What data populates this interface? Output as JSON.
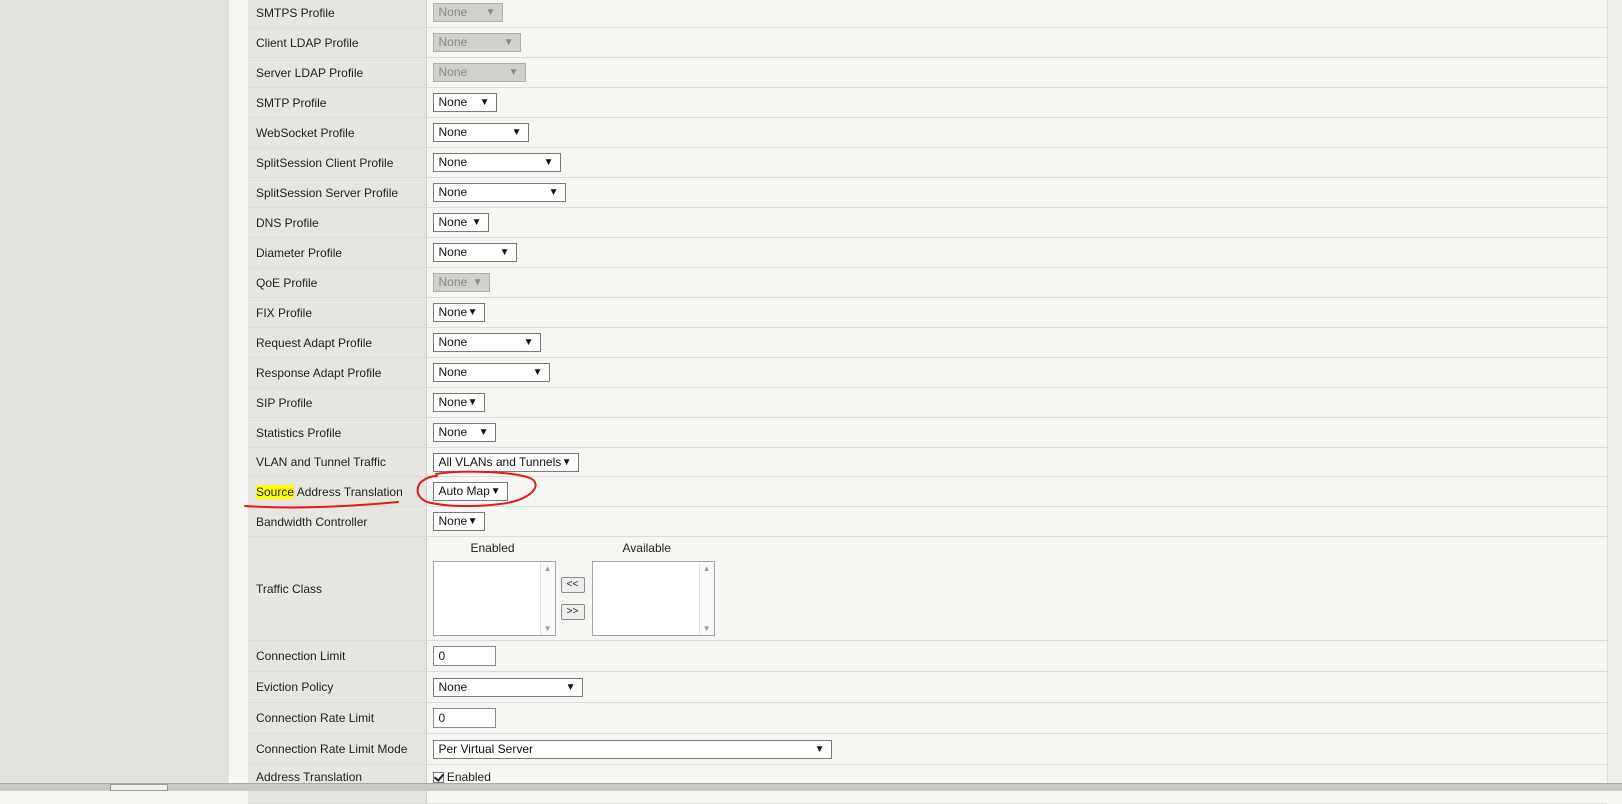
{
  "rows": [
    {
      "label": "SMTPS Profile",
      "value": "None",
      "disabled": true,
      "w": 70
    },
    {
      "label": "Client LDAP Profile",
      "value": "None",
      "disabled": true,
      "w": 88
    },
    {
      "label": "Server LDAP Profile",
      "value": "None",
      "disabled": true,
      "w": 93
    },
    {
      "label": "SMTP Profile",
      "value": "None",
      "disabled": false,
      "w": 64
    },
    {
      "label": "WebSocket Profile",
      "value": "None",
      "disabled": false,
      "w": 96
    },
    {
      "label": "SplitSession Client Profile",
      "value": "None",
      "disabled": false,
      "w": 128
    },
    {
      "label": "SplitSession Server Profile",
      "value": "None",
      "disabled": false,
      "w": 133
    },
    {
      "label": "DNS Profile",
      "value": "None",
      "disabled": false,
      "w": 56
    },
    {
      "label": "Diameter Profile",
      "value": "None",
      "disabled": false,
      "w": 84
    },
    {
      "label": "QoE Profile",
      "value": "None",
      "disabled": true,
      "w": 57
    },
    {
      "label": "FIX Profile",
      "value": "None",
      "disabled": false,
      "w": 52
    },
    {
      "label": "Request Adapt Profile",
      "value": "None",
      "disabled": false,
      "w": 108
    },
    {
      "label": "Response Adapt Profile",
      "value": "None",
      "disabled": false,
      "w": 117
    },
    {
      "label": "SIP Profile",
      "value": "None",
      "disabled": false,
      "w": 52
    },
    {
      "label": "Statistics Profile",
      "value": "None",
      "disabled": false,
      "w": 63
    },
    {
      "label": "VLAN and Tunnel Traffic",
      "value": "All VLANs and Tunnels",
      "disabled": false,
      "w": 146
    }
  ],
  "sat": {
    "label_highlight": "Source",
    "label_rest": " Address Translation",
    "value": "Auto Map"
  },
  "bandwidth": {
    "label": "Bandwidth Controller",
    "value": "None"
  },
  "traffic": {
    "label": "Traffic Class",
    "enabled": "Enabled",
    "available": "Available",
    "btn_left": "<<",
    "btn_right": ">>"
  },
  "conn_limit": {
    "label": "Connection Limit",
    "value": "0"
  },
  "eviction": {
    "label": "Eviction Policy",
    "value": "None"
  },
  "conn_rate": {
    "label": "Connection Rate Limit",
    "value": "0"
  },
  "conn_rate_mode": {
    "label": "Connection Rate Limit Mode",
    "value": "Per Virtual Server"
  },
  "addr_trans": {
    "label": "Address Translation",
    "value": "Enabled"
  }
}
